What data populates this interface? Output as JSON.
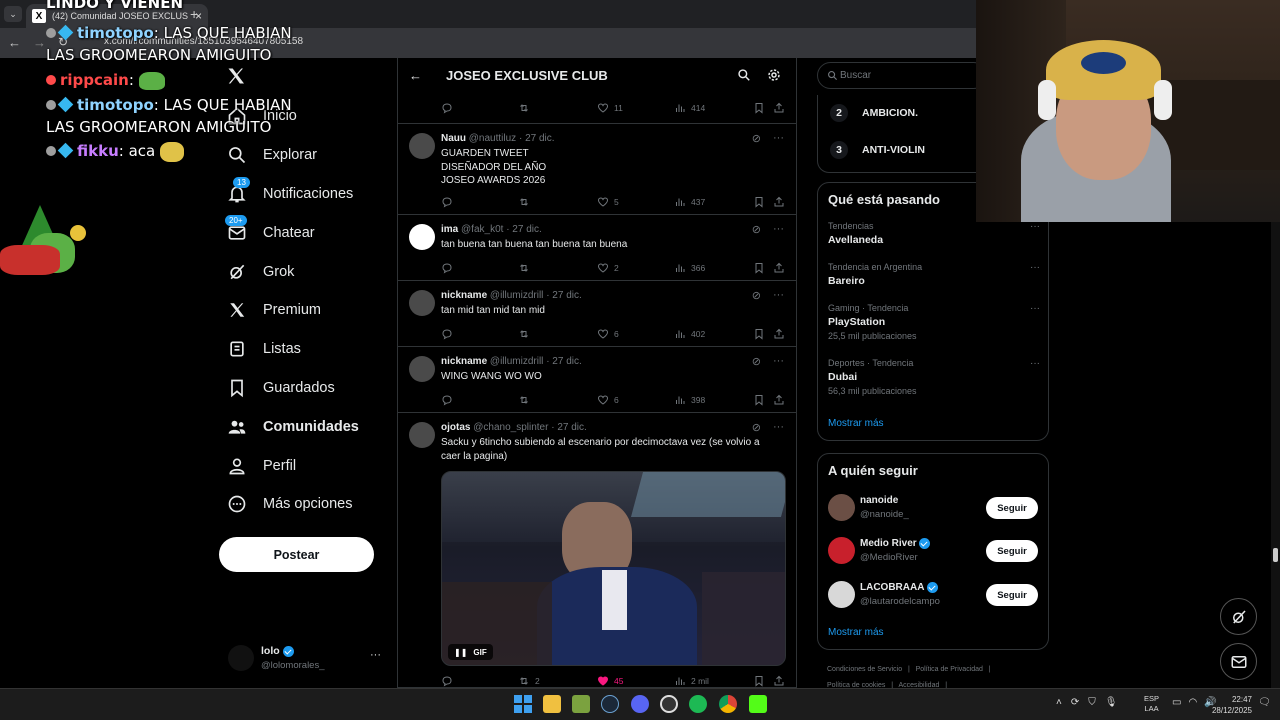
{
  "browser": {
    "tab_title": "(42) Comunidad JOSEO EXCLUS",
    "tab_close": "×",
    "new_tab": "+",
    "url": "x.com/i/communities/1851039546407805158"
  },
  "chat": {
    "partial_line": "LINDO Y VIENEN",
    "messages": [
      {
        "user": "timotopo",
        "user_color": "#8fd3ff",
        "text": ": LAS QUE HABIAN LAS GROOMEARON AMIGUITO"
      },
      {
        "user": "rippcain",
        "user_color": "#ff4a4a",
        "text": ":"
      },
      {
        "user": "timotopo",
        "user_color": "#8fd3ff",
        "text": ": LAS QUE HABIAN LAS GROOMEARON AMIGUITO"
      },
      {
        "user": "fikku",
        "user_color": "#c77dff",
        "text": ": aca"
      }
    ]
  },
  "nav": {
    "items": [
      {
        "label": "Inicio",
        "icon": "home-icon"
      },
      {
        "label": "Explorar",
        "icon": "search-icon"
      },
      {
        "label": "Notificaciones",
        "icon": "bell-icon",
        "badge": "13"
      },
      {
        "label": "Chatear",
        "icon": "mail-icon",
        "badge": "20+"
      },
      {
        "label": "Grok",
        "icon": "grok-icon"
      },
      {
        "label": "Premium",
        "icon": "x-logo-icon"
      },
      {
        "label": "Listas",
        "icon": "list-icon"
      },
      {
        "label": "Guardados",
        "icon": "bookmark-icon"
      },
      {
        "label": "Comunidades",
        "icon": "people-icon"
      },
      {
        "label": "Perfil",
        "icon": "person-icon"
      },
      {
        "label": "Más opciones",
        "icon": "more-circle-icon"
      }
    ],
    "post_label": "Postear",
    "account": {
      "name": "lolo",
      "handle": "@lolomorales_",
      "more": "···"
    }
  },
  "feed": {
    "title": "JOSEO EXCLUSIVE CLUB",
    "first_actions": {
      "likes": "11",
      "views": "414"
    },
    "tweets": [
      {
        "name": "Nauu",
        "handle": "@nauttiluz",
        "date": "· 27 dic.",
        "lines": [
          "GUARDEN TWEET",
          "DISEÑADOR DEL AÑO",
          "JOSEO AWARDS 2026"
        ],
        "replies": "",
        "retweets": "",
        "likes": "5",
        "views": "437"
      },
      {
        "name": "ima",
        "handle": "@fak_k0t",
        "date": "· 27 dic.",
        "lines": [
          "tan buena tan buena tan buena tan buena"
        ],
        "replies": "",
        "retweets": "",
        "likes": "2",
        "views": "366"
      },
      {
        "name": "nickname",
        "handle": "@illumizdrill",
        "date": "· 27 dic.",
        "lines": [
          "tan mid tan mid tan mid"
        ],
        "replies": "",
        "retweets": "",
        "likes": "6",
        "views": "402"
      },
      {
        "name": "nickname",
        "handle": "@illumizdrill",
        "date": "· 27 dic.",
        "lines": [
          "WING WANG WO WO"
        ],
        "replies": "",
        "retweets": "",
        "likes": "6",
        "views": "398"
      },
      {
        "name": "ojotas",
        "handle": "@chano_splinter",
        "date": "· 27 dic.",
        "lines": [
          "Sacku y 6tincho subiendo al escenario por decimoctava vez (se volvio a",
          "caer la pagina)"
        ],
        "replies": "",
        "retweets": "2",
        "likes": "45",
        "views": "2 mil",
        "gif_label": "GIF"
      }
    ]
  },
  "sidebar": {
    "search_placeholder": "Buscar",
    "top_list": [
      {
        "rank": "2",
        "name": "AMBICION."
      },
      {
        "rank": "3",
        "name": "ANTI-VIOLIN"
      }
    ],
    "trends_title": "Qué está pasando",
    "trends": [
      {
        "meta": "Tendencias",
        "name": "Avellaneda",
        "count": ""
      },
      {
        "meta": "Tendencia en Argentina",
        "name": "Bareiro",
        "count": ""
      },
      {
        "meta": "Gaming · Tendencia",
        "name": "PlayStation",
        "count": "25,5 mil publicaciones"
      },
      {
        "meta": "Deportes · Tendencia",
        "name": "Dubai",
        "count": "56,3 mil publicaciones"
      }
    ],
    "show_more": "Mostrar más",
    "follow_title": "A quién seguir",
    "follow": [
      {
        "name": "nanoide",
        "handle": "@nanoide_",
        "verified": false,
        "button": "Seguir"
      },
      {
        "name": "Medio River",
        "handle": "@MedioRiver",
        "verified": true,
        "button": "Seguir"
      },
      {
        "name": "LACOBRAAA",
        "handle": "@lautarodelcampo",
        "verified": true,
        "button": "Seguir"
      }
    ],
    "follow_more": "Mostrar más",
    "footer": [
      "Condiciones de Servicio",
      "|",
      "Política de Privacidad",
      "|",
      "Política de cookies",
      "|",
      "Accesibilidad",
      "|"
    ]
  },
  "taskbar": {
    "lang_top": "ESP",
    "lang_bottom": "LAA",
    "time": "22:47",
    "date": "28/12/2025"
  },
  "colors": {
    "accent": "#1d9bf0",
    "like_active": "#f91880",
    "border": "#2f3336",
    "muted": "#71767b"
  }
}
